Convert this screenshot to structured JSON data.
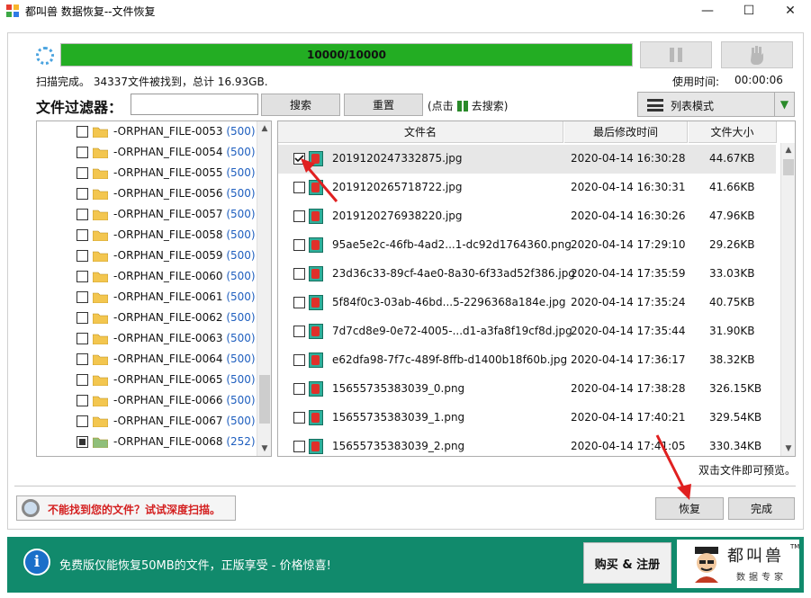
{
  "window": {
    "title": "都叫兽 数据恢复--文件恢复",
    "minimize": "—",
    "maximize": "☐",
    "close": "✕"
  },
  "scan": {
    "progress_text": "10000/10000",
    "progress_value": 1.0,
    "status": "扫描完成。 34337文件被找到，总计 16.93GB.",
    "elapsed_label": "使用时间:",
    "elapsed_value": "00:00:06"
  },
  "filter": {
    "label": "文件过滤器：",
    "input_value": "",
    "search_button": "搜索",
    "reset_button": "重置",
    "hint_before": "(点击",
    "hint_after": "去搜索)"
  },
  "view_mode": {
    "label": "列表模式"
  },
  "tree": {
    "items": [
      {
        "name": "-ORPHAN_FILE-0053",
        "count": "(500)",
        "state": "unchecked"
      },
      {
        "name": "-ORPHAN_FILE-0054",
        "count": "(500)",
        "state": "unchecked"
      },
      {
        "name": "-ORPHAN_FILE-0055",
        "count": "(500)",
        "state": "unchecked"
      },
      {
        "name": "-ORPHAN_FILE-0056",
        "count": "(500)",
        "state": "unchecked"
      },
      {
        "name": "-ORPHAN_FILE-0057",
        "count": "(500)",
        "state": "unchecked"
      },
      {
        "name": "-ORPHAN_FILE-0058",
        "count": "(500)",
        "state": "unchecked"
      },
      {
        "name": "-ORPHAN_FILE-0059",
        "count": "(500)",
        "state": "unchecked"
      },
      {
        "name": "-ORPHAN_FILE-0060",
        "count": "(500)",
        "state": "unchecked"
      },
      {
        "name": "-ORPHAN_FILE-0061",
        "count": "(500)",
        "state": "unchecked"
      },
      {
        "name": "-ORPHAN_FILE-0062",
        "count": "(500)",
        "state": "unchecked"
      },
      {
        "name": "-ORPHAN_FILE-0063",
        "count": "(500)",
        "state": "unchecked"
      },
      {
        "name": "-ORPHAN_FILE-0064",
        "count": "(500)",
        "state": "unchecked"
      },
      {
        "name": "-ORPHAN_FILE-0065",
        "count": "(500)",
        "state": "unchecked"
      },
      {
        "name": "-ORPHAN_FILE-0066",
        "count": "(500)",
        "state": "unchecked"
      },
      {
        "name": "-ORPHAN_FILE-0067",
        "count": "(500)",
        "state": "unchecked"
      },
      {
        "name": "-ORPHAN_FILE-0068",
        "count": "(252)",
        "state": "partial"
      }
    ]
  },
  "list": {
    "headers": {
      "name": "文件名",
      "modified": "最后修改时间",
      "size": "文件大小"
    },
    "rows": [
      {
        "name": "2019120247332875.jpg",
        "modified": "2020-04-14 16:30:28",
        "size": "44.67KB",
        "checked": true
      },
      {
        "name": "2019120265718722.jpg",
        "modified": "2020-04-14 16:30:31",
        "size": "41.66KB",
        "checked": false
      },
      {
        "name": "2019120276938220.jpg",
        "modified": "2020-04-14 16:30:26",
        "size": "47.96KB",
        "checked": false
      },
      {
        "name": "95ae5e2c-46fb-4ad2...1-dc92d1764360.png",
        "modified": "2020-04-14 17:29:10",
        "size": "29.26KB",
        "checked": false
      },
      {
        "name": "23d36c33-89cf-4ae0-8a30-6f33ad52f386.jpg",
        "modified": "2020-04-14 17:35:59",
        "size": "33.03KB",
        "checked": false
      },
      {
        "name": "5f84f0c3-03ab-46bd...5-2296368a184e.jpg",
        "modified": "2020-04-14 17:35:24",
        "size": "40.75KB",
        "checked": false
      },
      {
        "name": "7d7cd8e9-0e72-4005-...d1-a3fa8f19cf8d.jpg",
        "modified": "2020-04-14 17:35:44",
        "size": "31.90KB",
        "checked": false
      },
      {
        "name": "e62dfa98-7f7c-489f-8ffb-d1400b18f60b.jpg",
        "modified": "2020-04-14 17:36:17",
        "size": "38.32KB",
        "checked": false
      },
      {
        "name": "15655735383039_0.png",
        "modified": "2020-04-14 17:38:28",
        "size": "326.15KB",
        "checked": false
      },
      {
        "name": "15655735383039_1.png",
        "modified": "2020-04-14 17:40:21",
        "size": "329.54KB",
        "checked": false
      },
      {
        "name": "15655735383039_2.png",
        "modified": "2020-04-14 17:41:05",
        "size": "330.34KB",
        "checked": false
      }
    ],
    "preview_hint": "双击文件即可预览。"
  },
  "actions": {
    "deep_scan": "不能找到您的文件？试试深度扫描。",
    "recover": "恢复",
    "finish": "完成"
  },
  "footer": {
    "notice": "免费版仅能恢复50MB的文件，正版享受 - 价格惊喜!",
    "buy_button": "购买 & 注册",
    "brand_name": "都叫兽",
    "brand_sub": "数据专家",
    "brand_tm": "TM",
    "info_icon": "i",
    "colors": {
      "green": "#118a6c",
      "progress": "#23ad23",
      "warning": "#d42020"
    }
  }
}
